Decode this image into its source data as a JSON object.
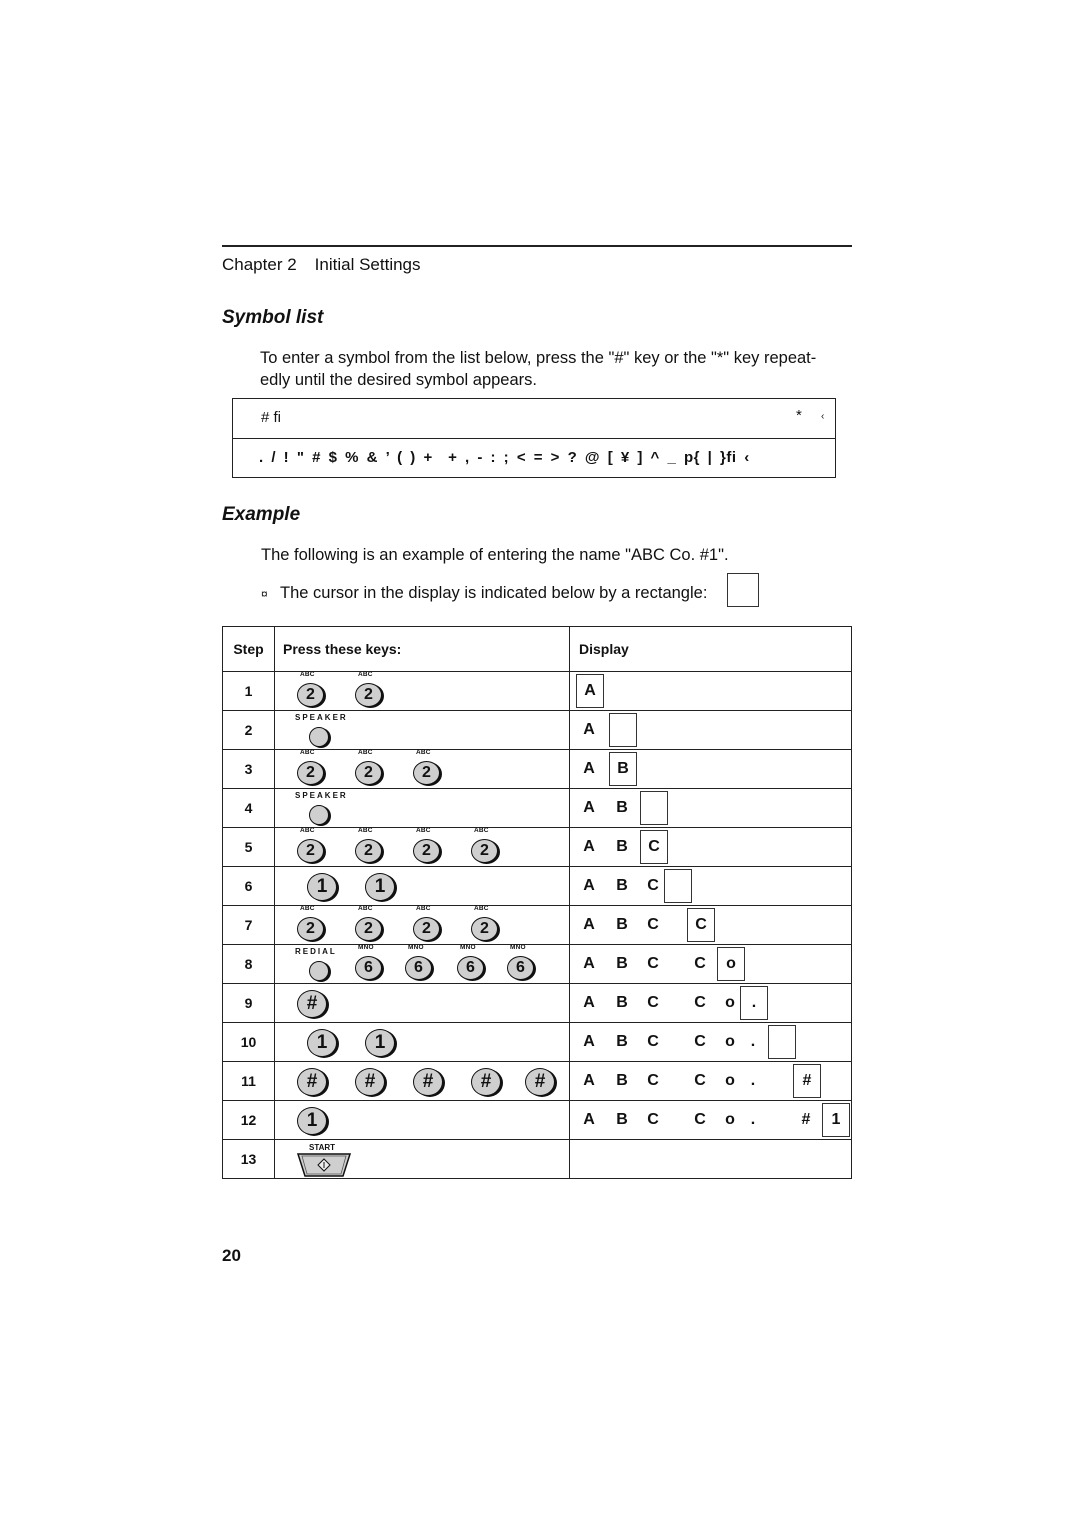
{
  "header": {
    "chapter": "Chapter 2",
    "section": "Initial Settings"
  },
  "symbol_list": {
    "heading": "Symbol list",
    "instruction_line1": "To enter a symbol from the list below, press the \"#\" key or the \"*\" key repeat-",
    "instruction_line2": "edly until the desired symbol appears.",
    "box": {
      "row1_left": "# fi",
      "row1_right_star": "*",
      "row1_right_arrow": "‹",
      "row2_symbols": ". / ! \" # $ % & ’ ( ) +  + , - : ; < = > ? @ [ ¥ ] ^ _ p{ | }fi ‹"
    }
  },
  "example": {
    "heading": "Example",
    "intro": "The following is an example of entering the name \"ABC Co. #1\".",
    "note_bullet": "¤",
    "note": "The cursor in the display is indicated below by a rectangle:"
  },
  "table": {
    "headers": {
      "step": "Step",
      "keys": "Press these keys:",
      "display": "Display"
    },
    "rows": [
      {
        "step": "1",
        "keys": [
          {
            "type": "num",
            "label": "2",
            "cap": "ABC"
          },
          {
            "type": "num",
            "label": "2",
            "cap": "ABC"
          }
        ],
        "display": {
          "chars": [
            "A"
          ],
          "cursor_index": 0
        }
      },
      {
        "step": "2",
        "keys": [
          {
            "type": "plain",
            "cap": "SPEAKER"
          }
        ],
        "display": {
          "chars": [
            "A",
            ""
          ],
          "cursor_index": 1
        }
      },
      {
        "step": "3",
        "keys": [
          {
            "type": "num",
            "label": "2",
            "cap": "ABC"
          },
          {
            "type": "num",
            "label": "2",
            "cap": "ABC"
          },
          {
            "type": "num",
            "label": "2",
            "cap": "ABC"
          }
        ],
        "display": {
          "chars": [
            "A",
            "B"
          ],
          "cursor_index": 1
        }
      },
      {
        "step": "4",
        "keys": [
          {
            "type": "plain",
            "cap": "SPEAKER"
          }
        ],
        "display": {
          "chars": [
            "A",
            "B",
            ""
          ],
          "cursor_index": 2
        }
      },
      {
        "step": "5",
        "keys": [
          {
            "type": "num",
            "label": "2",
            "cap": "ABC"
          },
          {
            "type": "num",
            "label": "2",
            "cap": "ABC"
          },
          {
            "type": "num",
            "label": "2",
            "cap": "ABC"
          },
          {
            "type": "num",
            "label": "2",
            "cap": "ABC"
          }
        ],
        "display": {
          "chars": [
            "A",
            "B",
            "C"
          ],
          "cursor_index": 2
        }
      },
      {
        "step": "6",
        "keys": [
          {
            "type": "big",
            "label": "1"
          },
          {
            "type": "big",
            "label": "1"
          }
        ],
        "display": {
          "chars": [
            "A",
            "B",
            "C",
            ""
          ],
          "cursor_index": 3
        }
      },
      {
        "step": "7",
        "keys": [
          {
            "type": "num",
            "label": "2",
            "cap": "ABC"
          },
          {
            "type": "num",
            "label": "2",
            "cap": "ABC"
          },
          {
            "type": "num",
            "label": "2",
            "cap": "ABC"
          },
          {
            "type": "num",
            "label": "2",
            "cap": "ABC"
          }
        ],
        "display": {
          "chars": [
            "A",
            "B",
            "C",
            "",
            "C"
          ],
          "cursor_index": 4
        }
      },
      {
        "step": "8",
        "keys": [
          {
            "type": "plain",
            "cap": "REDIAL"
          },
          {
            "type": "num",
            "label": "6",
            "cap": "MNO"
          },
          {
            "type": "num",
            "label": "6",
            "cap": "MNO"
          },
          {
            "type": "num",
            "label": "6",
            "cap": "MNO"
          },
          {
            "type": "num",
            "label": "6",
            "cap": "MNO"
          }
        ],
        "display": {
          "chars": [
            "A",
            "B",
            "C",
            "",
            "C",
            "o"
          ],
          "cursor_index": 5
        }
      },
      {
        "step": "9",
        "keys": [
          {
            "type": "hash",
            "label": "#"
          }
        ],
        "display": {
          "chars": [
            "A",
            "B",
            "C",
            "",
            "C",
            "o",
            "."
          ],
          "cursor_index": 6
        }
      },
      {
        "step": "10",
        "keys": [
          {
            "type": "big",
            "label": "1"
          },
          {
            "type": "big",
            "label": "1"
          }
        ],
        "display": {
          "chars": [
            "A",
            "B",
            "C",
            "",
            "C",
            "o",
            ".",
            ""
          ],
          "cursor_index": 7
        }
      },
      {
        "step": "11",
        "keys": [
          {
            "type": "hash",
            "label": "#"
          },
          {
            "type": "hash",
            "label": "#"
          },
          {
            "type": "hash",
            "label": "#"
          },
          {
            "type": "hash",
            "label": "#"
          },
          {
            "type": "hash",
            "label": "#"
          }
        ],
        "display": {
          "chars": [
            "A",
            "B",
            "C",
            "",
            "C",
            "o",
            ".",
            "",
            "#"
          ],
          "cursor_index": 8
        }
      },
      {
        "step": "12",
        "keys": [
          {
            "type": "big",
            "label": "1"
          }
        ],
        "display": {
          "chars": [
            "A",
            "B",
            "C",
            "",
            "C",
            "o",
            ".",
            "",
            "#",
            "1"
          ],
          "cursor_index": 9
        }
      },
      {
        "step": "13",
        "keys": [
          {
            "type": "start",
            "cap": "START",
            "label": "◇"
          }
        ],
        "display": {
          "chars": [],
          "cursor_index": -1
        }
      }
    ]
  },
  "page_number": "20"
}
